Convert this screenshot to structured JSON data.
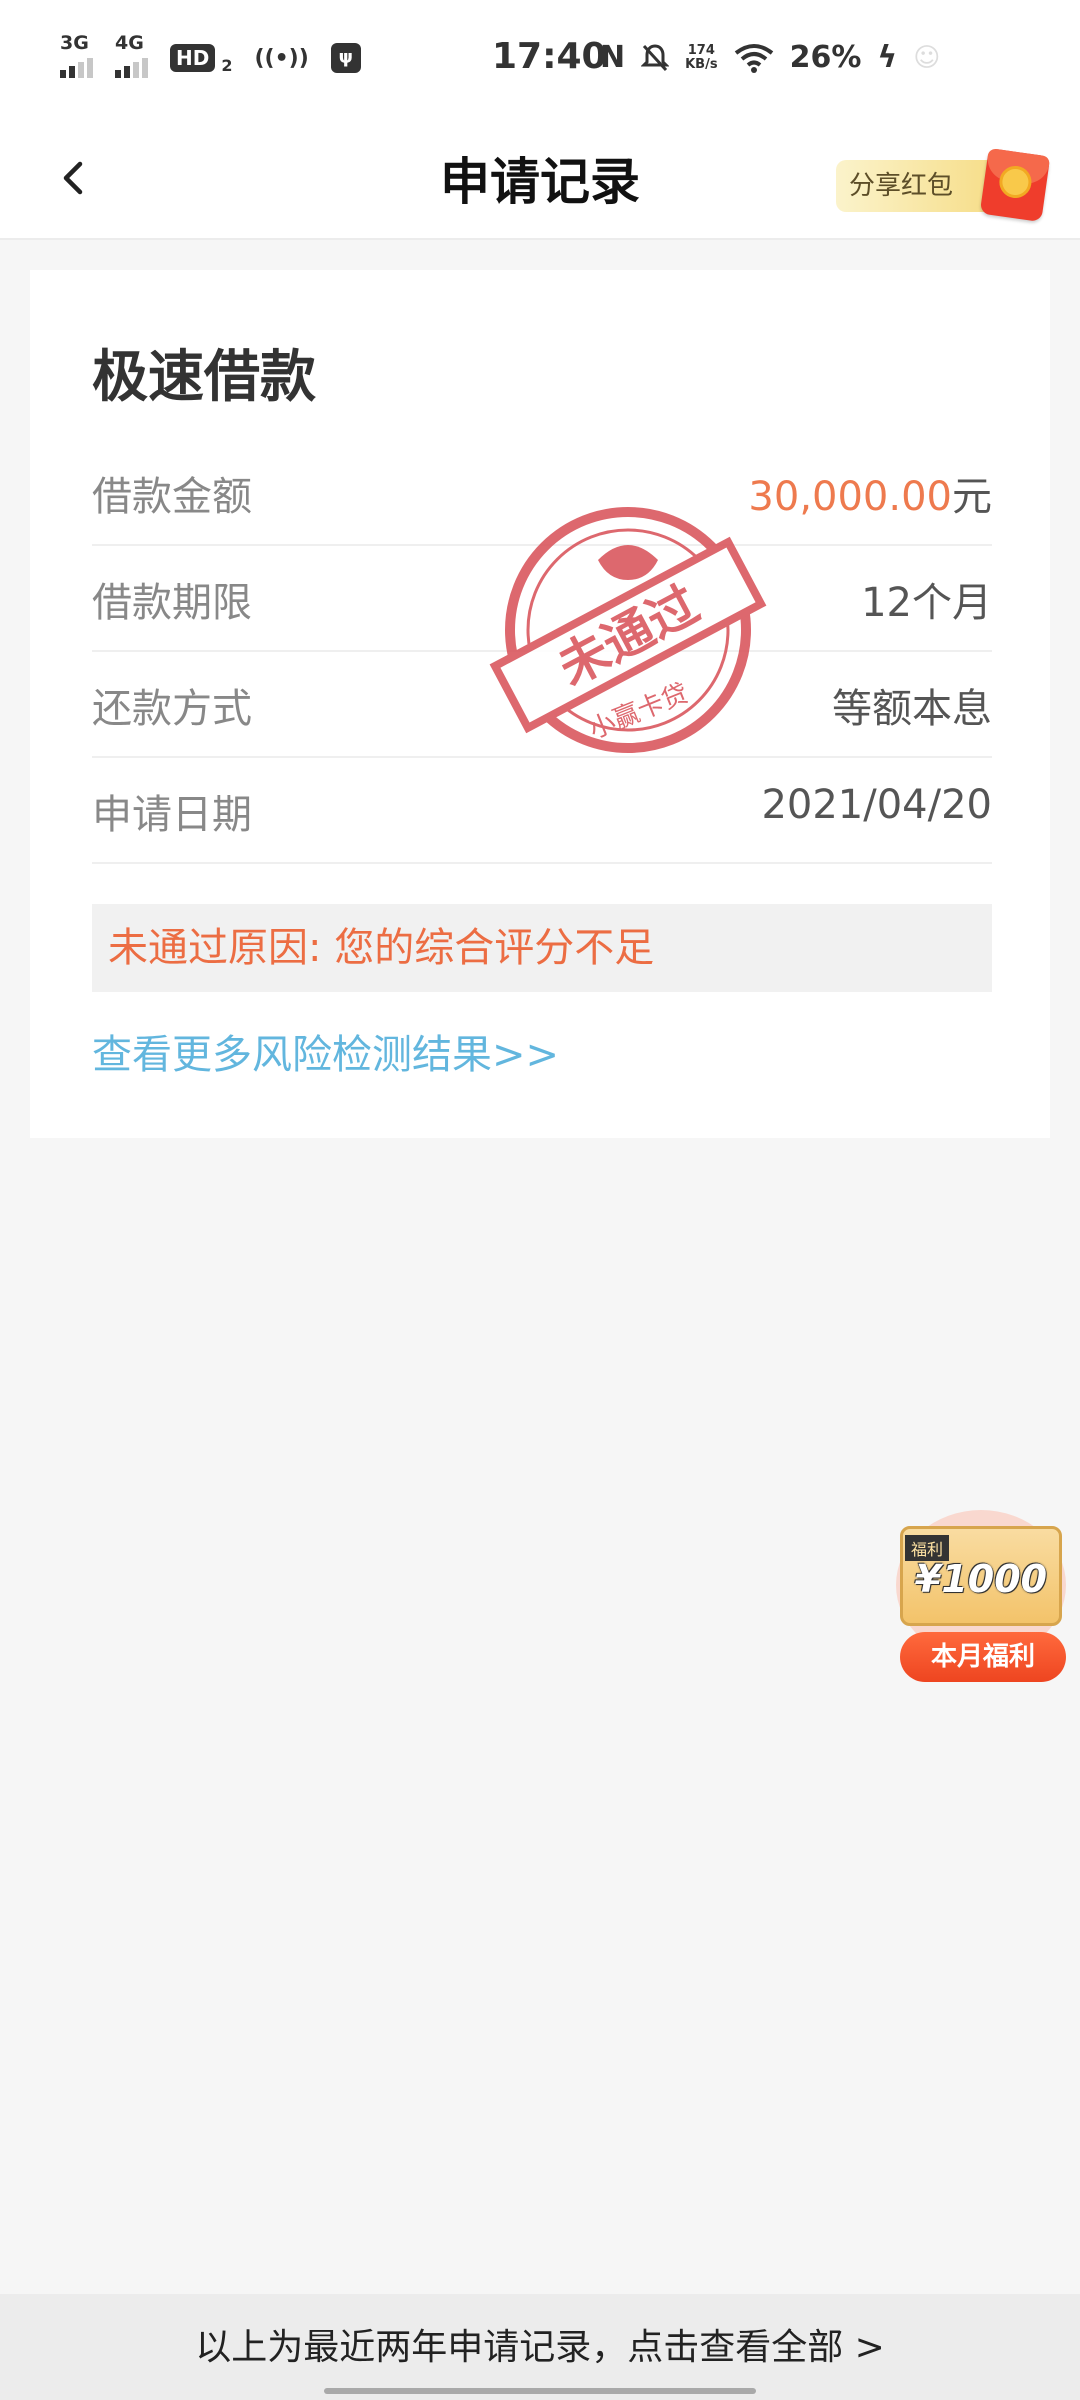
{
  "status_bar": {
    "net1": "3G",
    "net2": "4G",
    "hd": "HD",
    "hd_sub": "2",
    "time": "17:40",
    "speed_value": "174",
    "speed_unit": "KB/s",
    "battery": "26%"
  },
  "nav": {
    "title": "申请记录",
    "share_label": "分享红包"
  },
  "card": {
    "title": "极速借款",
    "rows": [
      {
        "label": "借款金额",
        "value_amount": "30,000.00",
        "value_unit": "元"
      },
      {
        "label": "借款期限",
        "value": "12个月"
      },
      {
        "label": "还款方式",
        "value": "等额本息"
      },
      {
        "label": "申请日期",
        "value": "2021/04/20"
      }
    ],
    "stamp_main": "未通过",
    "stamp_brand": "小赢卡贷",
    "reject_reason": "未通过原因: 您的综合评分不足",
    "risk_link": "查看更多风险检测结果>>"
  },
  "reward": {
    "tag": "福利",
    "amount": "¥1000",
    "button": "本月福利"
  },
  "footer": {
    "text": "以上为最近两年申请记录，点击查看全部 >"
  }
}
